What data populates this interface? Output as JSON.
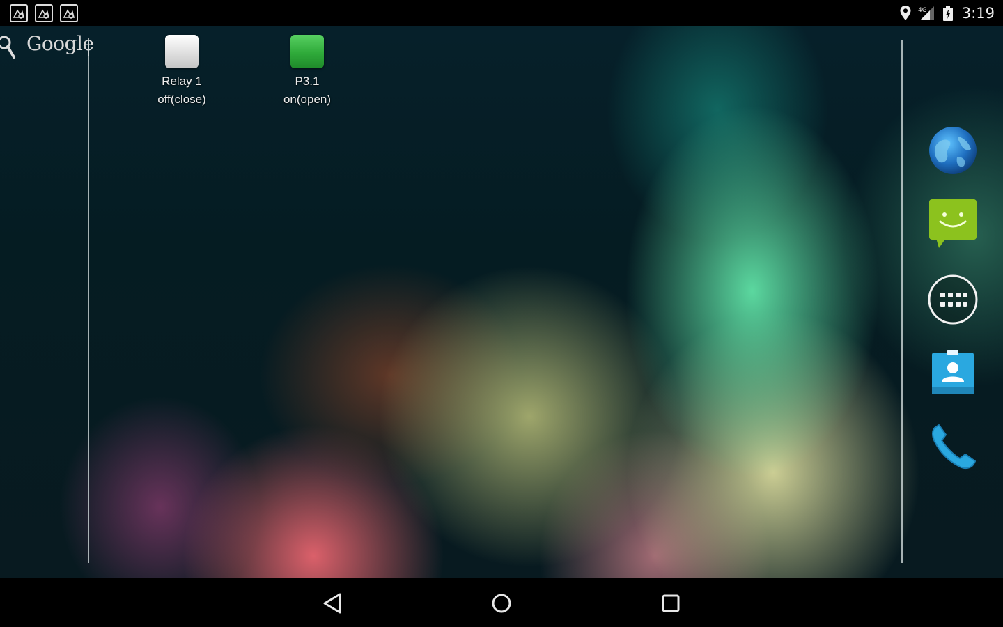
{
  "status_bar": {
    "time": "3:19",
    "notification_icons": [
      "app-notification-icon",
      "app-notification-icon",
      "app-notification-icon"
    ],
    "indicator_icons": [
      "location-icon",
      "cellular-signal-icon",
      "battery-icon"
    ]
  },
  "search": {
    "logo_text": "Google"
  },
  "widgets": [
    {
      "title": "Relay 1",
      "state": "off(close)",
      "color": "#e2e2e2"
    },
    {
      "title": "P3.1",
      "state": "on(open)",
      "color": "#2faa3a"
    }
  ],
  "dock": [
    {
      "icon": "browser-globe-icon"
    },
    {
      "icon": "messaging-icon"
    },
    {
      "icon": "app-drawer-icon"
    },
    {
      "icon": "contacts-icon"
    },
    {
      "icon": "phone-icon"
    }
  ],
  "nav": {
    "buttons": [
      "back-icon",
      "home-icon",
      "recents-icon"
    ]
  },
  "colors": {
    "accent_blue": "#2aa8e0",
    "message_green": "#8cc21e"
  }
}
